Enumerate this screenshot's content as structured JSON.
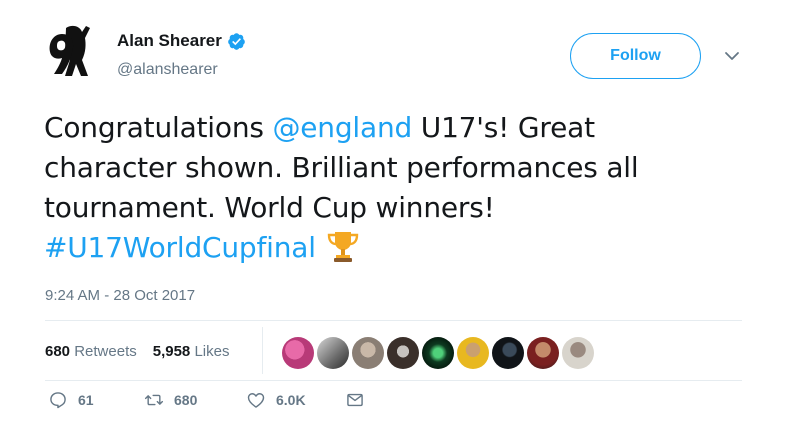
{
  "author": {
    "name": "Alan Shearer",
    "handle": "@alanshearer",
    "verified": true,
    "avatar_icon": "alan-shearer-9-logo"
  },
  "follow_label": "Follow",
  "tweet": {
    "text_start": "Congratulations ",
    "mention": "@england",
    "text_line1_end": " U17's! Great",
    "line2": "character shown. Brilliant performances all",
    "line3": "tournament. World Cup winners!",
    "hashtag": "#U17WorldCupfinal",
    "emoji_icon": "trophy-icon"
  },
  "timestamp": "9:24 AM - 28 Oct 2017",
  "stats": {
    "retweets_count": "680",
    "retweets_label": "Retweets",
    "likes_count": "5,958",
    "likes_label": "Likes"
  },
  "actions": {
    "replies": "61",
    "retweets": "680",
    "likes": "6.0K"
  },
  "colors": {
    "accent": "#1da1f2",
    "muted": "#657786",
    "text": "#14171a",
    "trophy": "#f4a823"
  }
}
